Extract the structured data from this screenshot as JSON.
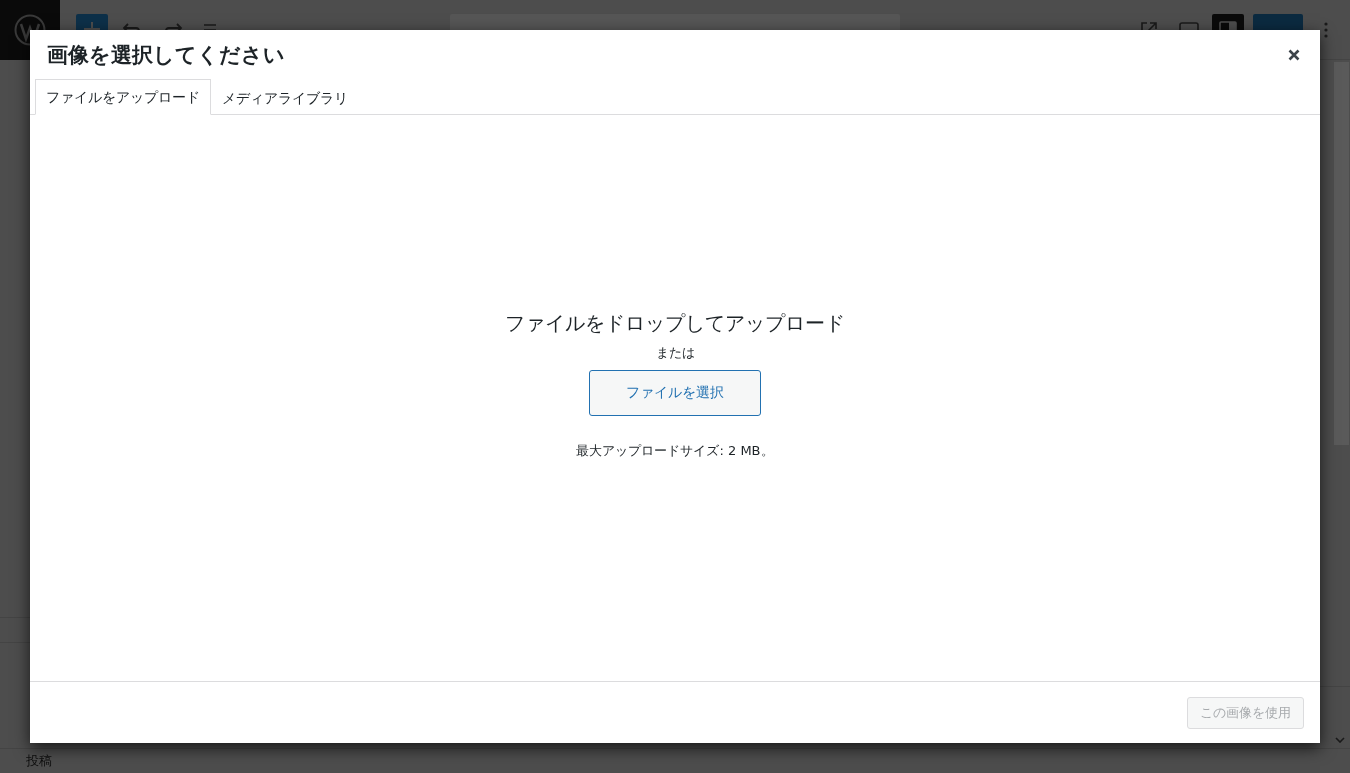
{
  "editor": {
    "footer_breadcrumb": "投稿"
  },
  "modal": {
    "title": "画像を選択してください",
    "tabs": [
      {
        "label": "ファイルをアップロード",
        "selected": true
      },
      {
        "label": "メディアライブラリ",
        "selected": false
      }
    ],
    "uploader": {
      "heading": "ファイルをドロップしてアップロード",
      "separator": "または",
      "select_button": "ファイルを選択",
      "max_size_note": "最大アップロードサイズ: 2 MB。"
    },
    "footer": {
      "primary_button": {
        "label": "この画像を使用",
        "disabled": true
      }
    }
  }
}
